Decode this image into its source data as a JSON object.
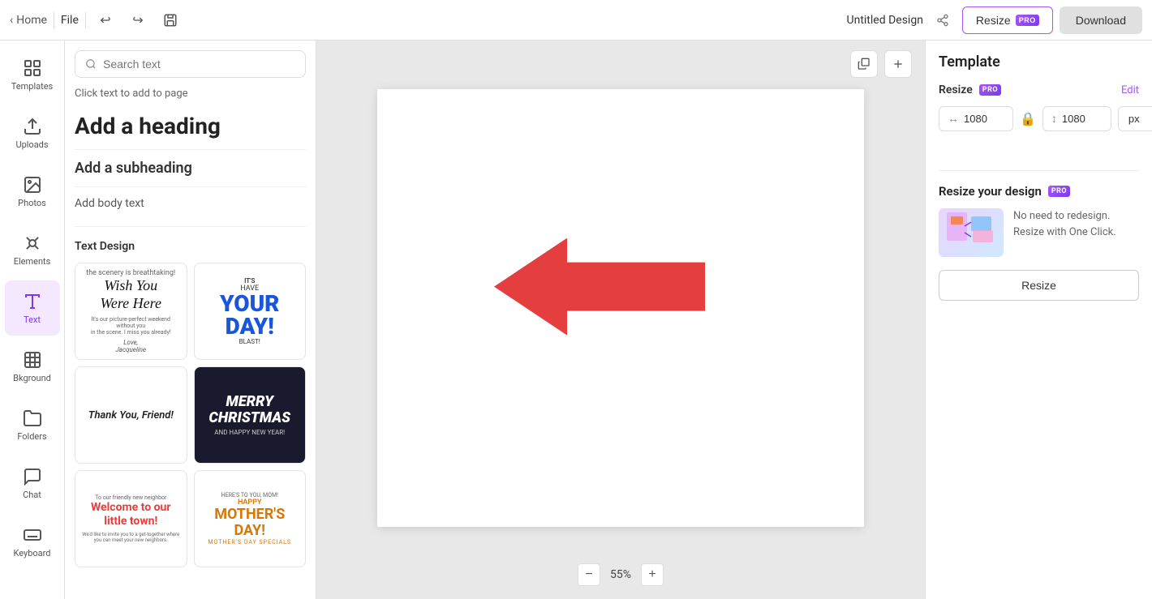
{
  "topbar": {
    "home_label": "Home",
    "file_label": "File",
    "title": "Untitled Design",
    "resize_label": "Resize",
    "download_label": "Download",
    "pro_label": "PRO"
  },
  "sidebar": {
    "items": [
      {
        "id": "templates",
        "label": "Templates",
        "icon": "grid"
      },
      {
        "id": "uploads",
        "label": "Uploads",
        "icon": "upload"
      },
      {
        "id": "photos",
        "label": "Photos",
        "icon": "image"
      },
      {
        "id": "elements",
        "label": "Elements",
        "icon": "shapes"
      },
      {
        "id": "text",
        "label": "Text",
        "icon": "text",
        "active": true
      },
      {
        "id": "background",
        "label": "Bkground",
        "icon": "background"
      },
      {
        "id": "folders",
        "label": "Folders",
        "icon": "folder"
      },
      {
        "id": "chat",
        "label": "Chat",
        "icon": "chat"
      },
      {
        "id": "keyboard",
        "label": "Keyboard",
        "icon": "keyboard"
      }
    ]
  },
  "left_panel": {
    "search_placeholder": "Search text",
    "click_hint": "Click text to add to page",
    "add_heading": "Add a heading",
    "add_subheading": "Add a subheading",
    "add_body": "Add body text",
    "text_design_title": "Text Design",
    "cards": [
      {
        "id": "wish",
        "type": "wish"
      },
      {
        "id": "its-your-day",
        "type": "its"
      },
      {
        "id": "thankyou",
        "type": "thankyou"
      },
      {
        "id": "merry",
        "type": "merry"
      },
      {
        "id": "welcome",
        "type": "welcome"
      },
      {
        "id": "mother",
        "type": "mother"
      }
    ]
  },
  "canvas": {
    "zoom_level": "55%",
    "zoom_minus": "−",
    "zoom_plus": "+"
  },
  "right_panel": {
    "title": "Template",
    "resize_label": "Resize",
    "pro_label": "PRO",
    "edit_label": "Edit",
    "width": "1080",
    "height": "1080",
    "unit": "px",
    "cta_title": "Resize your design",
    "cta_pro": "PRO",
    "cta_desc": "No need to redesign. Resize with One Click.",
    "cta_button": "Resize"
  }
}
